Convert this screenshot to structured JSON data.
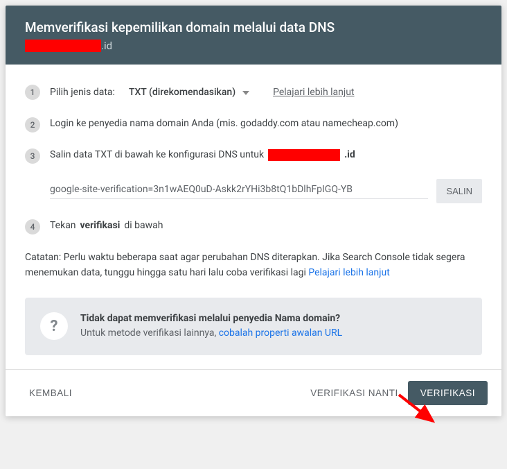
{
  "header": {
    "title": "Memverifikasi kepemilikan domain melalui data DNS",
    "domain_suffix": ".id"
  },
  "steps": {
    "s1": {
      "num": "1",
      "label": "Pilih jenis data:",
      "select_value": "TXT (direkomendasikan)",
      "learn": "Pelajari lebih lanjut"
    },
    "s2": {
      "num": "2",
      "text": "Login ke penyedia nama domain Anda (mis. godaddy.com atau namecheap.com)"
    },
    "s3": {
      "num": "3",
      "text_before": "Salin data TXT di bawah ke konfigurasi DNS untuk",
      "domain_suffix": ".id"
    },
    "s4": {
      "num": "4",
      "text_before": "Tekan ",
      "bold": "verifikasi",
      "text_after": " di bawah"
    }
  },
  "txt": {
    "value": "google-site-verification=3n1wAEQ0uD-Askk2rYHi3b8tQ1bDlhFpIGQ-YB",
    "copy": "SALIN"
  },
  "note": {
    "text": "Catatan: Perlu waktu beberapa saat agar perubahan DNS diterapkan. Jika Search Console tidak segera menemukan data, tunggu hingga satu hari lalu coba verifikasi lagi ",
    "link": "Pelajari lebih lanjut"
  },
  "help": {
    "title": "Tidak dapat memverifikasi melalui penyedia Nama domain?",
    "body": "Untuk metode verifikasi lainnya, ",
    "link": "cobalah properti awalan URL"
  },
  "footer": {
    "back": "KEMBALI",
    "later": "VERIFIKASI NANTI",
    "verify": "VERIFIKASI"
  }
}
